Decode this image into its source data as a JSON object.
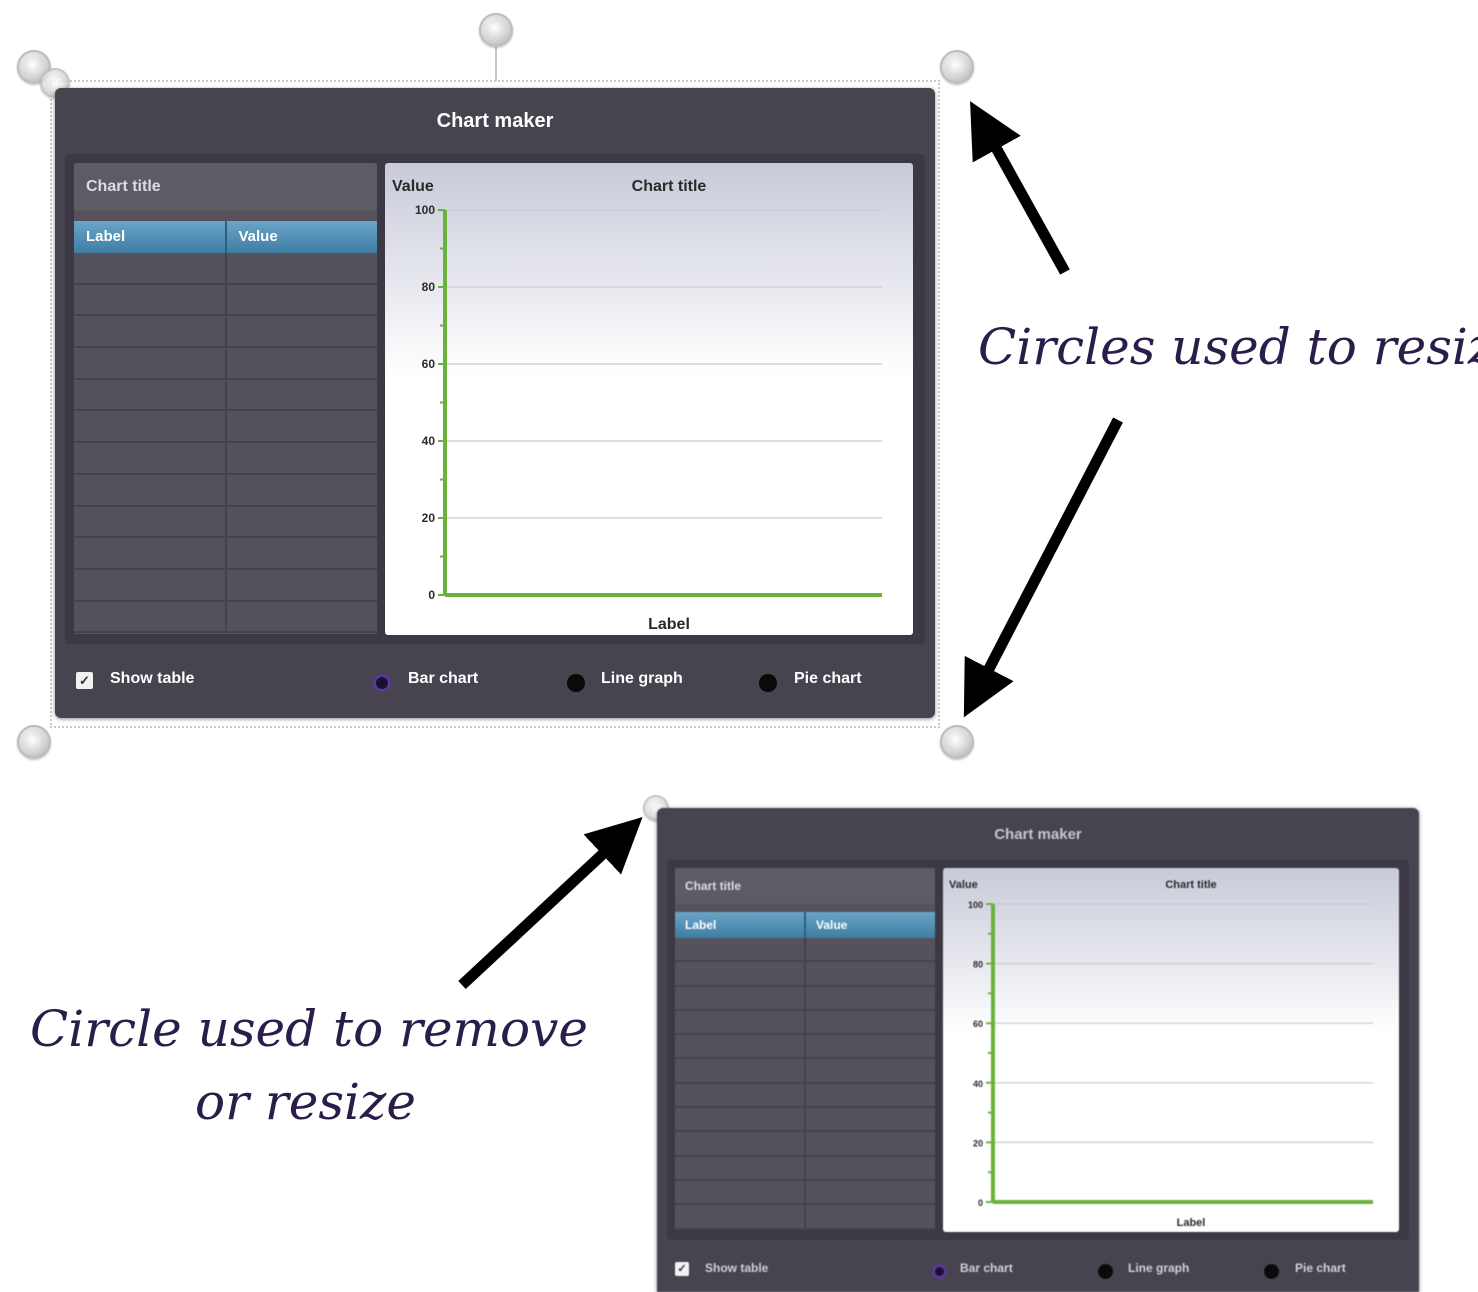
{
  "main_widget": {
    "title": "Chart maker",
    "table": {
      "chart_title_field": "Chart title",
      "columns": [
        "Label",
        "Value"
      ],
      "row_count": 12
    },
    "chart": {
      "title": "Chart title",
      "ylabel": "Value",
      "xlabel": "Label",
      "ticks": [
        "100",
        "80",
        "60",
        "40",
        "20",
        "0"
      ]
    },
    "footer": {
      "show_table_label": "Show table",
      "show_table_checked": true,
      "options": [
        "Bar chart",
        "Line graph",
        "Pie chart"
      ],
      "selected_option": "Bar chart"
    }
  },
  "small_widget": {
    "title": "Chart maker",
    "table": {
      "chart_title_field": "Chart title",
      "columns": [
        "Label",
        "Value"
      ],
      "row_count": 12
    },
    "chart": {
      "title": "Chart title",
      "ylabel": "Value",
      "xlabel": "Label",
      "ticks": [
        "100",
        "80",
        "60",
        "40",
        "20",
        "0"
      ]
    },
    "footer": {
      "show_table_label": "Show table",
      "options": [
        "Bar chart",
        "Line graph",
        "Pie chart"
      ]
    }
  },
  "annotations": {
    "resize_note": "Circles used to resize",
    "remove_note_line1": "Circle used to remove",
    "remove_note_line2": "or resize"
  },
  "colors": {
    "widget_bg": "#48444f",
    "header_blue": "#5a97bd",
    "axis_green": "#6ab23c",
    "note_ink": "#2a1d4a",
    "radio_selected": "#6a2fd0"
  }
}
